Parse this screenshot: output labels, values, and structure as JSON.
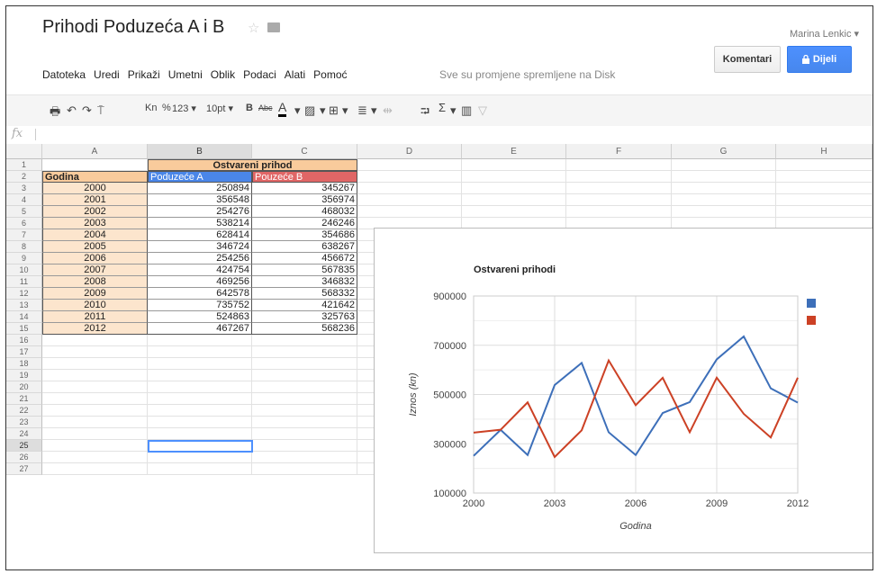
{
  "doc": {
    "title": "Prihodi Poduzeća A i B",
    "saved_msg": "Sve su promjene spremljene na Disk"
  },
  "user": {
    "name": "Marina Lenkic ▾"
  },
  "menu": {
    "items": [
      "Datoteka",
      "Uredi",
      "Prikaži",
      "Umetni",
      "Oblik",
      "Podaci",
      "Alati",
      "Pomoć"
    ]
  },
  "buttons": {
    "comments": "Komentari",
    "share": "Dijeli"
  },
  "toolbar": {
    "currency": "Kn",
    "percent": "%",
    "number_fmt": "123 ▾",
    "font_size": "10pt ▾",
    "bold": "B",
    "strikethrough": "Abc",
    "text_color": "A",
    "sigma": "Σ"
  },
  "formula_bar": {
    "fx": "fx"
  },
  "sheet": {
    "columns": [
      "A",
      "B",
      "C",
      "D",
      "E",
      "F",
      "G",
      "H"
    ],
    "row_numbers": [
      "1",
      "2",
      "3",
      "4",
      "5",
      "6",
      "7",
      "8",
      "9",
      "10",
      "11",
      "12",
      "13",
      "14",
      "15",
      "16",
      "17",
      "18",
      "19",
      "20",
      "21",
      "22",
      "23",
      "24",
      "25",
      "26",
      "27"
    ],
    "merged_header": "Ostvareni prihod",
    "headers": [
      "Godina",
      "Poduzeće A",
      "Pouzeće B"
    ],
    "rows": [
      [
        "2000",
        "250894",
        "345267"
      ],
      [
        "2001",
        "356548",
        "356974"
      ],
      [
        "2002",
        "254276",
        "468032"
      ],
      [
        "2003",
        "538214",
        "246246"
      ],
      [
        "2004",
        "628414",
        "354686"
      ],
      [
        "2005",
        "346724",
        "638267"
      ],
      [
        "2006",
        "254256",
        "456672"
      ],
      [
        "2007",
        "424754",
        "567835"
      ],
      [
        "2008",
        "469256",
        "346832"
      ],
      [
        "2009",
        "642578",
        "568332"
      ],
      [
        "2010",
        "735752",
        "421642"
      ],
      [
        "2011",
        "524863",
        "325763"
      ],
      [
        "2012",
        "467267",
        "568236"
      ]
    ]
  },
  "colors": {
    "header_orange": "#f9cb9c",
    "header_blue": "#4a86e8",
    "header_red": "#e06666",
    "year_fill": "#fce5cd",
    "series_a": "#3d6fb9",
    "series_b": "#cc4125"
  },
  "chart_data": {
    "type": "line",
    "title": "Ostvareni prihodi",
    "xlabel": "Godina",
    "ylabel": "Iznos (kn)",
    "x": [
      2000,
      2001,
      2002,
      2003,
      2004,
      2005,
      2006,
      2007,
      2008,
      2009,
      2010,
      2011,
      2012
    ],
    "x_ticks": [
      "2000",
      "2003",
      "2006",
      "2009",
      "2012"
    ],
    "y_ticks": [
      "100000",
      "300000",
      "500000",
      "700000",
      "900000"
    ],
    "ylim": [
      100000,
      900000
    ],
    "xlim": [
      2000,
      2012
    ],
    "grid": true,
    "legend": "right",
    "series": [
      {
        "values": [
          250894,
          356548,
          254276,
          538214,
          628414,
          346724,
          254256,
          424754,
          469256,
          642578,
          735752,
          524863,
          467267
        ],
        "color": "#3d6fb9"
      },
      {
        "values": [
          345267,
          356974,
          468032,
          246246,
          354686,
          638267,
          456672,
          567835,
          346832,
          568332,
          421642,
          325763,
          568236
        ],
        "color": "#cc4125"
      }
    ]
  }
}
